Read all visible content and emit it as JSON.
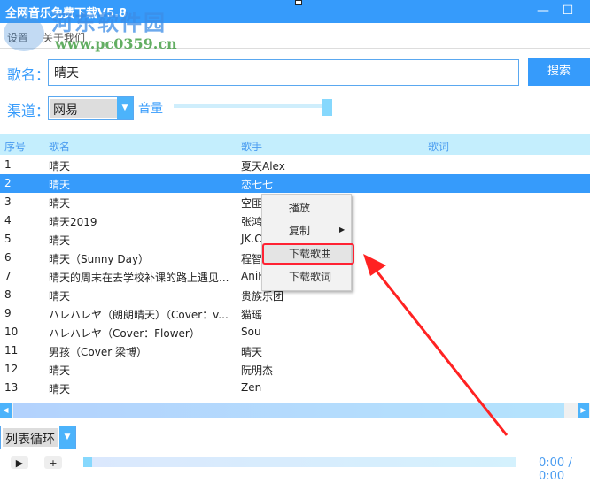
{
  "window": {
    "title": "全网音乐免费下载V5.8",
    "minimize": "—",
    "maximize": "☐"
  },
  "menu": [
    "设置",
    "关于我们"
  ],
  "watermark": {
    "name": "河东软件园",
    "url": "www.pc0359.cn"
  },
  "search": {
    "label": "歌名：",
    "value": "晴天",
    "button": "搜索"
  },
  "channel": {
    "label": "渠道：",
    "value": "网易",
    "volume_label": "音量",
    "volume": 0.95
  },
  "table": {
    "headers": [
      "序号",
      "歌名",
      "歌手",
      "歌词"
    ],
    "rows": [
      [
        "1",
        "晴天",
        "夏天Alex"
      ],
      [
        "2",
        " 晴天",
        "恋七七"
      ],
      [
        "3",
        "晴天",
        "空匪"
      ],
      [
        "4",
        "晴天2019",
        "张鸿"
      ],
      [
        "5",
        "晴天",
        "JK.C"
      ],
      [
        "6",
        "晴天（Sunny Day）",
        "程智"
      ],
      [
        "7",
        "晴天的周末在去学校补课的路上遇见...",
        "AniF"
      ],
      [
        "8",
        "晴天",
        "贵族乐团"
      ],
      [
        "9",
        "ハレハレヤ（朗朗晴天）（Cover：v...",
        "猫瑶"
      ],
      [
        "10",
        "ハレハレヤ（Cover：Flower）",
        "Sou"
      ],
      [
        "11",
        "男孩（Cover 梁博）",
        "晴天"
      ],
      [
        "12",
        "晴天",
        "阮明杰"
      ],
      [
        "13",
        "晴天",
        "Zen"
      ]
    ],
    "selected_index": 1
  },
  "context_menu": {
    "items": [
      "播放",
      "复制",
      "下载歌曲",
      "下载歌词"
    ],
    "highlighted": "下载歌曲"
  },
  "playback": {
    "mode": "列表循环",
    "time": "0:00 / 0:00",
    "progress": 0,
    "play_icon": "▶",
    "next_icon": "+"
  },
  "colors": {
    "accent": "#369bfb",
    "header_bg": "#c4eefd",
    "annotation": "#ff2222"
  }
}
